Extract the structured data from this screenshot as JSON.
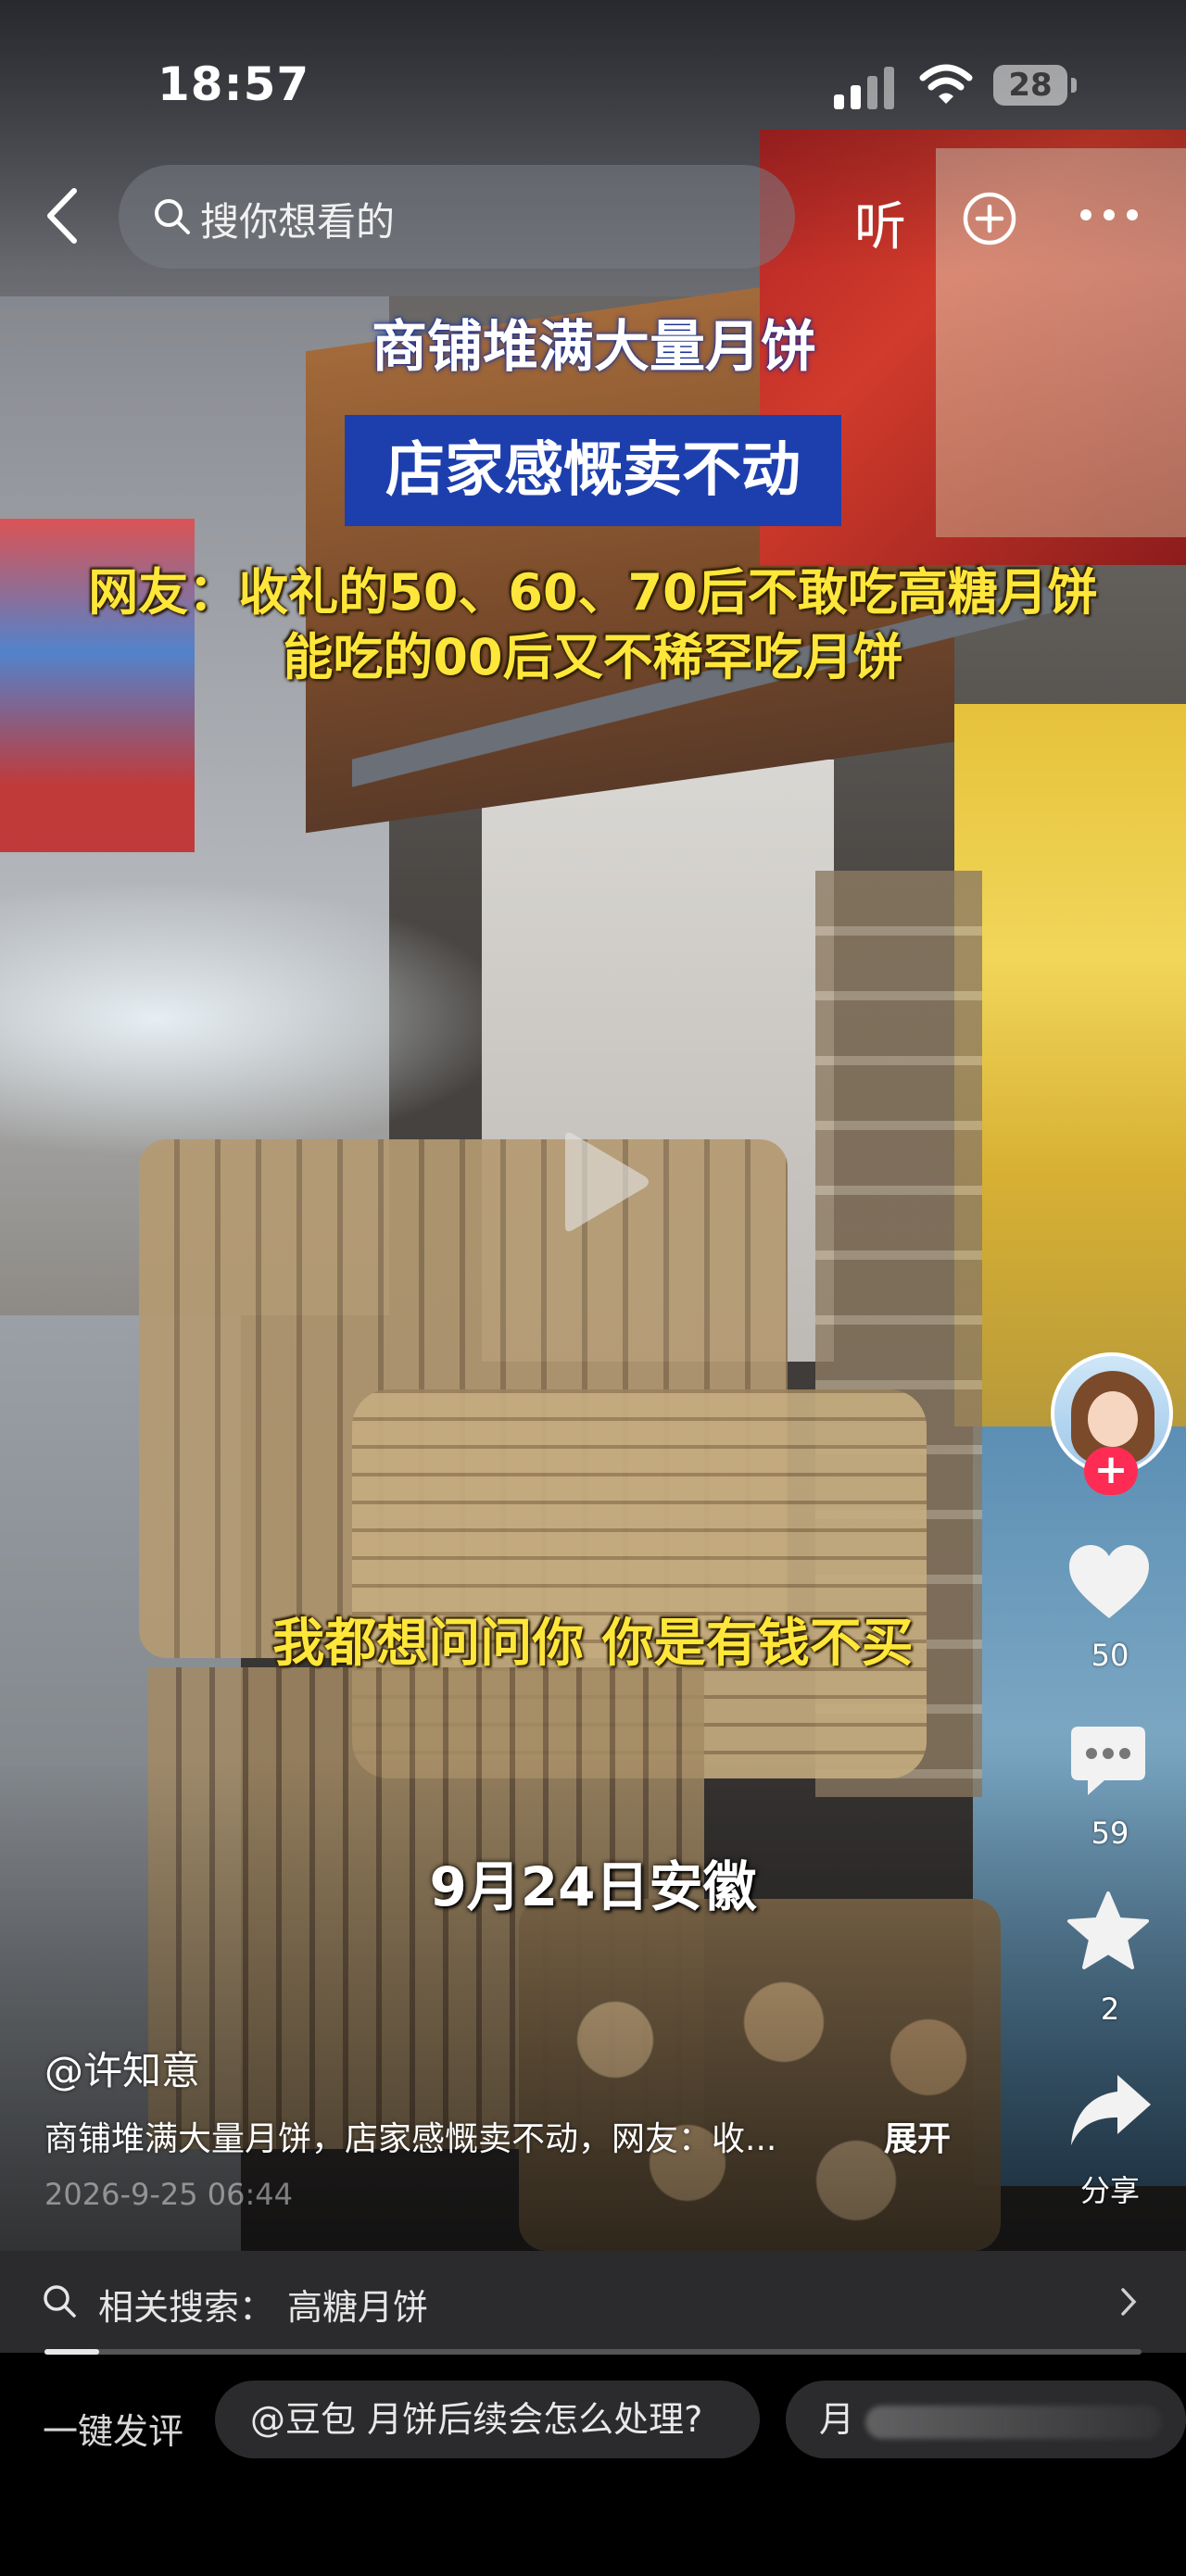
{
  "status_bar": {
    "time": "18:57",
    "battery": "28"
  },
  "top_bar": {
    "search_placeholder": "搜你想看的",
    "listen_label": "听"
  },
  "captions": {
    "title_line1": "商铺堆满大量月饼",
    "title_line2": "店家感慨卖不动",
    "netizen_line1": "网友：收礼的50、60、70后不敢吃高糖月饼",
    "netizen_line2": "能吃的00后又不稀罕吃月饼",
    "subtitle": "我都想问问你 你是有钱不买",
    "location_date": "9月24日安徽"
  },
  "actions": {
    "follow_symbol": "+",
    "like_count": "50",
    "comment_count": "59",
    "favorite_count": "2",
    "share_label": "分享"
  },
  "video": {
    "author": "@许知意",
    "description": "商铺堆满大量月饼，店家感慨卖不动，网友：收...",
    "expand_label": "展开",
    "date": "2026-9-25 06:44",
    "progress": 0.05
  },
  "related_search": {
    "label": "相关搜索：",
    "term": "高糖月饼"
  },
  "quick_comment": {
    "label": "一键发评",
    "chip_1": "@豆包 月饼后续会怎么处理?",
    "chip_2_prefix": "月"
  },
  "colors": {
    "caption_blue": "#1d3fae",
    "caption_yellow": "#ffe63a",
    "follow_red": "#fe2c55"
  }
}
